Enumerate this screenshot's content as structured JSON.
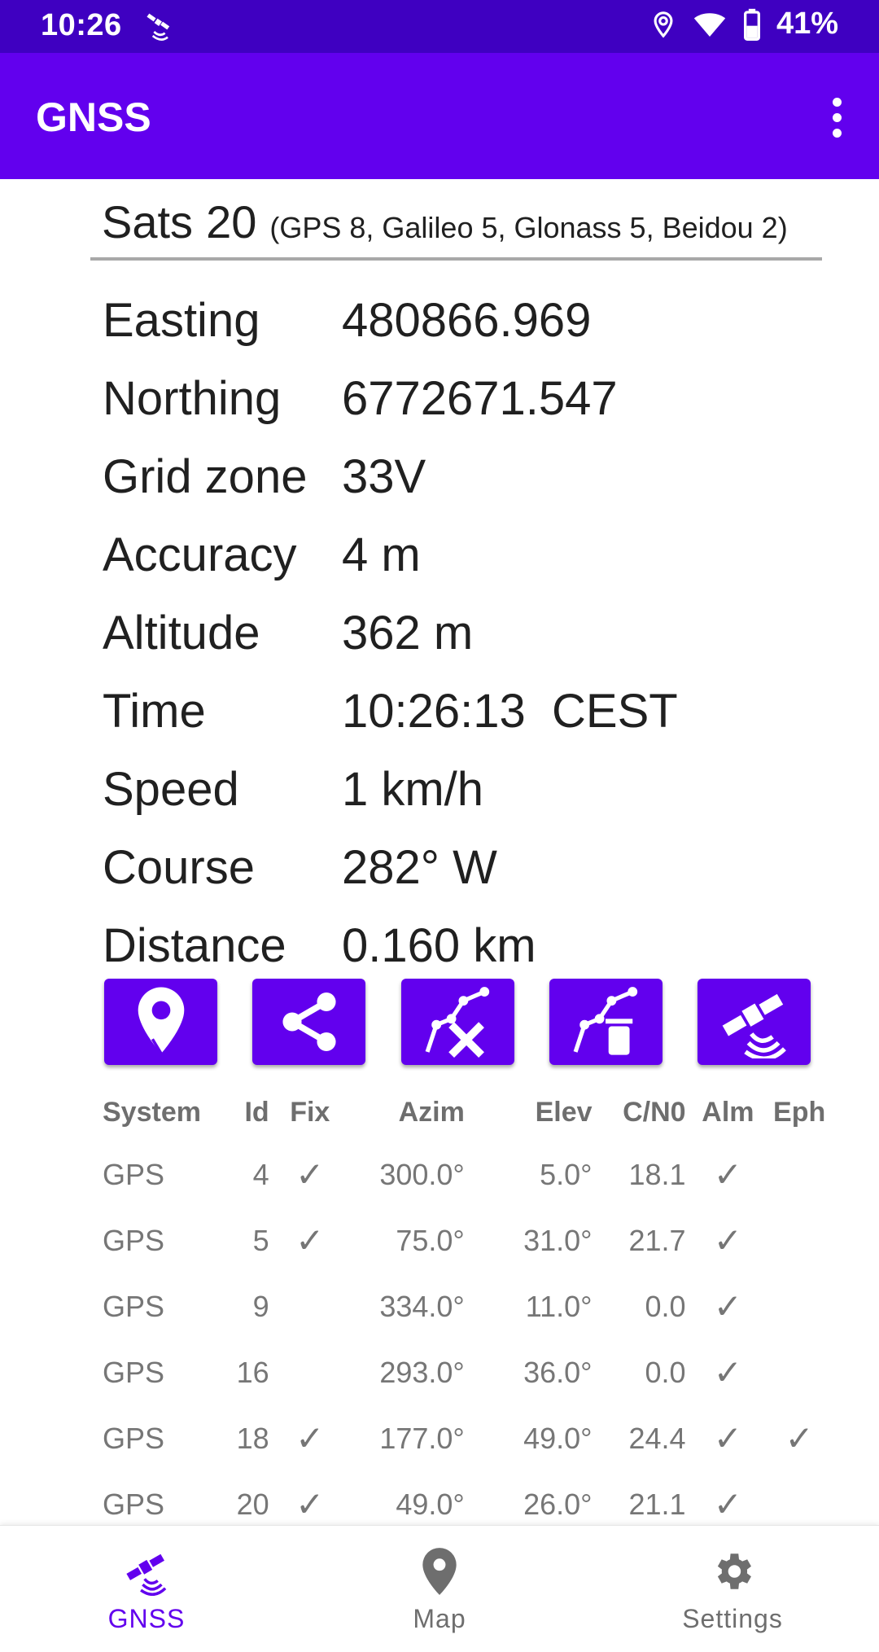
{
  "status_bar": {
    "time": "10:26",
    "battery": "41%",
    "icons": [
      "satellite-icon",
      "location-icon",
      "wifi-icon",
      "battery-icon"
    ]
  },
  "app_bar": {
    "title": "GNSS",
    "menu_icon": "more-vert-icon"
  },
  "sats": {
    "label": "Sats",
    "count": "20",
    "detail": "(GPS 8, Galileo 5, Glonass 5, Beidou 2)"
  },
  "info": [
    {
      "label": "Easting",
      "value": "480866.969"
    },
    {
      "label": "Northing",
      "value": "6772671.547"
    },
    {
      "label": "Grid zone",
      "value": "33V"
    },
    {
      "label": "Accuracy",
      "value": "4 m"
    },
    {
      "label": "Altitude",
      "value": "362 m"
    },
    {
      "label": "Time",
      "value": "10:26:13  CEST"
    },
    {
      "label": "Speed",
      "value": "1 km/h"
    },
    {
      "label": "Course",
      "value": "282° W"
    },
    {
      "label": "Distance",
      "value": "0.160 km"
    }
  ],
  "actions": [
    {
      "icon": "location-pin-icon"
    },
    {
      "icon": "share-icon"
    },
    {
      "icon": "clear-track-icon"
    },
    {
      "icon": "delete-track-icon"
    },
    {
      "icon": "satellite-signal-icon"
    }
  ],
  "table": {
    "headers": [
      "System",
      "Id",
      "Fix",
      "Azim",
      "Elev",
      "C/N0",
      "Alm",
      "Eph"
    ],
    "rows": [
      {
        "system": "GPS",
        "id": "4",
        "fix": "✓",
        "azim": "300.0°",
        "elev": "5.0°",
        "cn0": "18.1",
        "alm": "✓",
        "eph": ""
      },
      {
        "system": "GPS",
        "id": "5",
        "fix": "✓",
        "azim": "75.0°",
        "elev": "31.0°",
        "cn0": "21.7",
        "alm": "✓",
        "eph": ""
      },
      {
        "system": "GPS",
        "id": "9",
        "fix": "",
        "azim": "334.0°",
        "elev": "11.0°",
        "cn0": "0.0",
        "alm": "✓",
        "eph": ""
      },
      {
        "system": "GPS",
        "id": "16",
        "fix": "",
        "azim": "293.0°",
        "elev": "36.0°",
        "cn0": "0.0",
        "alm": "✓",
        "eph": ""
      },
      {
        "system": "GPS",
        "id": "18",
        "fix": "✓",
        "azim": "177.0°",
        "elev": "49.0°",
        "cn0": "24.4",
        "alm": "✓",
        "eph": "✓"
      },
      {
        "system": "GPS",
        "id": "20",
        "fix": "✓",
        "azim": "49.0°",
        "elev": "26.0°",
        "cn0": "21.1",
        "alm": "✓",
        "eph": ""
      }
    ]
  },
  "bottom_nav": [
    {
      "label": "GNSS",
      "icon": "satellite-icon",
      "active": true
    },
    {
      "label": "Map",
      "icon": "location-pin-icon",
      "active": false
    },
    {
      "label": "Settings",
      "icon": "gear-icon",
      "active": false
    }
  ],
  "colors": {
    "status_bar": "#3f00c1",
    "primary": "#6200ee",
    "text": "#202020",
    "table_text": "#767676"
  }
}
